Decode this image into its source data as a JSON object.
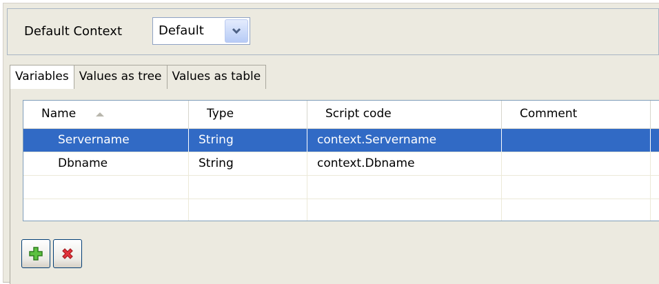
{
  "context": {
    "label": "Default Context",
    "selected": "Default"
  },
  "tabs": [
    {
      "label": "Variables",
      "active": true
    },
    {
      "label": "Values as tree",
      "active": false
    },
    {
      "label": "Values as table",
      "active": false
    }
  ],
  "table": {
    "columns": [
      "Name",
      "Type",
      "Script code",
      "Comment"
    ],
    "sort_column": "Name",
    "sort_direction": "ascending",
    "rows": [
      {
        "name": "Servername",
        "type": "String",
        "script": "context.Servername",
        "comment": "",
        "selected": true
      },
      {
        "name": "Dbname",
        "type": "String",
        "script": "context.Dbname",
        "comment": "",
        "selected": false
      },
      {
        "name": "",
        "type": "",
        "script": "",
        "comment": "",
        "selected": false
      },
      {
        "name": "",
        "type": "",
        "script": "",
        "comment": "",
        "selected": false
      }
    ]
  },
  "buttons": {
    "add_icon": "plus-icon",
    "remove_icon": "delete-x-icon"
  },
  "colors": {
    "selection": "#316ac5",
    "add_green": "#3a9a2a",
    "remove_red": "#d4212a"
  }
}
